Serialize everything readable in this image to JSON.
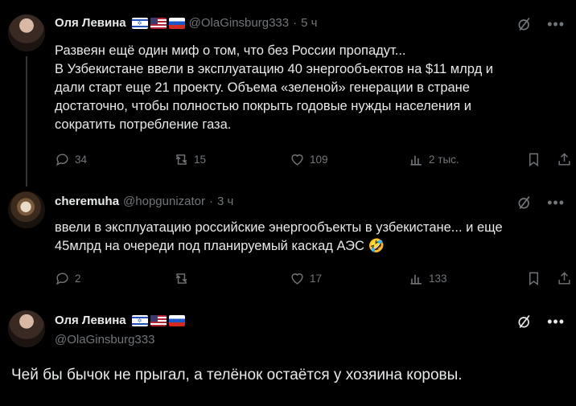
{
  "tweets": [
    {
      "name": "Оля Левина",
      "handle": "@OlaGinsburg333",
      "separator": "·",
      "time": "5 ч",
      "lines": [
        "Развеян ещё один миф о том, что без России пропадут...",
        "В Узбекистане ввели в эксплуатацию 40 энергообъектов на $11 млрд и",
        "дали старт еще 21 проекту. Объема «зеленой» генерации в стране",
        "достаточно, чтобы полностью покрыть годовые нужды населения и",
        "сократить потребление газа."
      ],
      "replies": "34",
      "reposts": "15",
      "likes": "109",
      "views": "2 тыс."
    },
    {
      "name": "cheremuha",
      "handle": "@hopgunizator",
      "separator": "·",
      "time": "3 ч",
      "lines": [
        "ввели в эксплуатацию российские энергообъекты в узбекистане... и еще",
        "45млрд на очереди под планируемый каскад АЭС 🤣"
      ],
      "replies": "2",
      "reposts": "",
      "likes": "17",
      "views": "133"
    }
  ],
  "main": {
    "name": "Оля Левина",
    "handle": "@OlaGinsburg333",
    "text": "Чей бы бычок не прыгал, а телёнок остаётся у хозяина коровы."
  },
  "icons": {
    "reply": "reply-icon",
    "repost": "repost-icon",
    "like": "like-icon",
    "views": "views-icon",
    "bookmark": "bookmark-icon",
    "grok": "grok-icon",
    "more": "more-icon"
  },
  "colors": {
    "background": "#000000",
    "text": "#e7e9ea",
    "muted": "#71767b",
    "divider": "#333639"
  }
}
